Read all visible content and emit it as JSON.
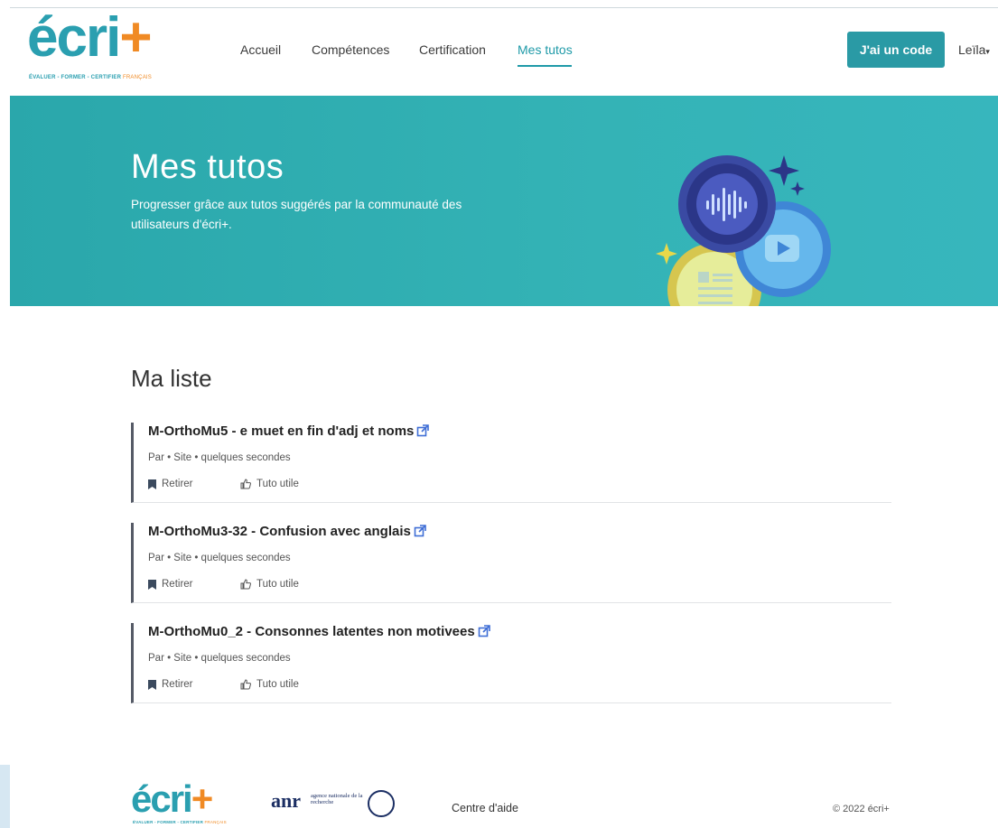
{
  "header": {
    "logo_text": "écri",
    "logo_plus": "+",
    "logo_tagline": "ÉVALUER - FORMER - CERTIFIER",
    "logo_tagline_lang": "FRANÇAIS",
    "nav": [
      {
        "label": "Accueil"
      },
      {
        "label": "Compétences"
      },
      {
        "label": "Certification"
      },
      {
        "label": "Mes tutos",
        "active": true
      }
    ],
    "code_button": "J'ai un code",
    "user_name": "Leïla",
    "user_caret": "▾"
  },
  "hero": {
    "title": "Mes tutos",
    "subtitle": "Progresser grâce aux tutos suggérés par la communauté des utilisateurs d'écri+."
  },
  "list": {
    "title": "Ma liste",
    "items": [
      {
        "title": "M-OrthoMu5 - e muet en fin d'adj et noms",
        "meta": "Par • Site • quelques secondes",
        "remove_label": "Retirer",
        "useful_label": "Tuto utile"
      },
      {
        "title": "M-OrthoMu3-32 - Confusion avec anglais",
        "meta": "Par • Site • quelques secondes",
        "remove_label": "Retirer",
        "useful_label": "Tuto utile"
      },
      {
        "title": "M-OrthoMu0_2 - Consonnes latentes non motivees",
        "meta": "Par • Site • quelques secondes",
        "remove_label": "Retirer",
        "useful_label": "Tuto utile"
      }
    ]
  },
  "footer": {
    "logo_text": "écri",
    "logo_plus": "+",
    "logo_tagline": "ÉVALUER - FORMER - CERTIFIER",
    "logo_tagline_lang": "FRANÇAIS",
    "anr_word": "anr",
    "anr_sub": "agence nationale de la recherche",
    "help_link": "Centre d'aide",
    "copyright": "© 2022 écri+"
  },
  "colors": {
    "brand_teal": "#2a9fb0",
    "brand_orange": "#f08a24",
    "hero_bg": "#34b3b6",
    "button_bg": "#2a9aa5",
    "nav_active": "#1f9aa8",
    "list_border": "#555a66"
  },
  "icons": {
    "external_link": "external-link-icon",
    "bookmark": "bookmark-icon",
    "thumbs_up": "thumbs-up-icon",
    "audio_wave": "audio-wave-icon",
    "play": "play-icon",
    "document": "document-icon",
    "sparkle": "sparkle-icon"
  }
}
